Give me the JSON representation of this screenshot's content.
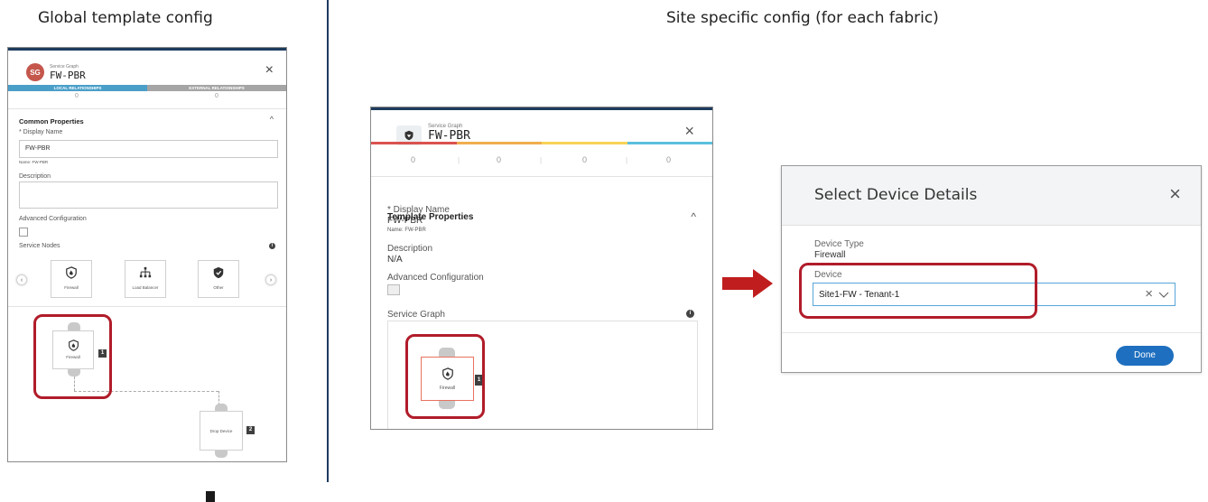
{
  "headings": {
    "left": "Global template config",
    "right": "Site specific config (for each fabric)"
  },
  "panel1": {
    "avatar": "SG",
    "subtitle": "Service Graph",
    "title": "FW-PBR",
    "close_icon": "×",
    "tabs": [
      "LOCAL RELATIONSHIPS",
      "EXTERNAL RELATIONSHIPS"
    ],
    "counts": [
      "0",
      "0"
    ],
    "section_title": "Common Properties",
    "caret": "^",
    "display_name_label": "* Display Name",
    "display_name_value": "FW-PBR",
    "name_hint": "Name: FW-PBR",
    "description_label": "Description",
    "advanced_label": "Advanced Configuration",
    "service_nodes_label": "Service Nodes",
    "info_icon": "i",
    "prev_arrow": "‹",
    "next_arrow": "›",
    "palette": [
      {
        "label": "Firewall",
        "icon": "firewall-icon"
      },
      {
        "label": "Load Balancer",
        "icon": "load-balancer-icon"
      },
      {
        "label": "Other",
        "icon": "other-icon"
      }
    ],
    "nodes": [
      {
        "label": "Firewall",
        "badge": "1"
      },
      {
        "label": "Drop Device",
        "badge": "2"
      }
    ]
  },
  "panel2": {
    "subtitle": "Service Graph",
    "title": "FW-PBR",
    "close_icon": "×",
    "counts": [
      "0",
      "0",
      "0",
      "0"
    ],
    "separator": "|",
    "colors": [
      "#d9534f",
      "#f0ad4e",
      "#f7d358",
      "#5bc0de"
    ],
    "section_title": "Template Properties",
    "caret": "^",
    "display_name_label": "* Display Name",
    "display_name_value": "FW-PBR",
    "name_hint": "Name: FW-PBR",
    "description_label": "Description",
    "description_value": "N/A",
    "advanced_label": "Advanced Configuration",
    "graph_label": "Service Graph",
    "info_icon": "i",
    "node": {
      "label": "Firewall",
      "badge": "1"
    }
  },
  "panel3": {
    "title": "Select Device Details",
    "close_icon": "×",
    "device_type_label": "Device Type",
    "device_type_value": "Firewall",
    "device_label": "Device",
    "device_value": "Site1-FW - Tenant-1",
    "clear_icon": "×",
    "done_button": "Done"
  },
  "colors": {
    "highlight_red": "#b11c2a",
    "accent_blue": "#1e6fbf",
    "tab_blue": "#4a9fc9",
    "divider_navy": "#1f3a5f"
  }
}
